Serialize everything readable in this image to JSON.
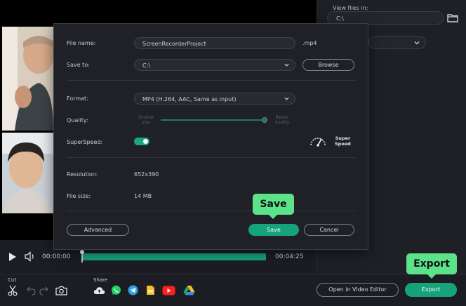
{
  "right_panel": {
    "view_files_label": "View files in:",
    "view_files_path": "C:\\"
  },
  "dialog": {
    "file_name_label": "File name:",
    "file_name_value": "ScreenRecorderProject",
    "extension": ".mp4",
    "save_to_label": "Save to:",
    "save_to_value": "C:\\",
    "browse_label": "Browse",
    "format_label": "Format:",
    "format_value": "MP4 (H.264, AAC, Same as input)",
    "quality_label": "Quality:",
    "quality_min_line1": "Smaller",
    "quality_min_line2": "size",
    "quality_max_line1": "Better",
    "quality_max_line2": "quality",
    "superspeed_label": "SuperSpeed:",
    "superspeed_on": true,
    "superspeed_badge_line1": "Super",
    "superspeed_badge_line2": "Speed",
    "resolution_label": "Resolution:",
    "resolution_value": "652x390",
    "filesize_label": "File size:",
    "filesize_value": "14 MB",
    "advanced_label": "Advanced",
    "save_label": "Save",
    "cancel_label": "Cancel"
  },
  "tooltips": {
    "save": "Save",
    "export": "Export"
  },
  "playback": {
    "current_time": "00:00:00",
    "end_time": "00:04:25",
    "progress": 1.0
  },
  "bottom": {
    "cut_label": "Cut",
    "share_label": "Share",
    "share_icons": [
      "cloud-icon",
      "whatsapp-icon",
      "telegram-icon",
      "google-drive-docs-icon",
      "youtube-icon",
      "google-drive-icon"
    ],
    "open_editor_label": "Open in Video Editor",
    "export_label": "Export"
  },
  "colors": {
    "accent": "#17a37a",
    "tooltip": "#5be28a",
    "background": "#1b1d22"
  }
}
